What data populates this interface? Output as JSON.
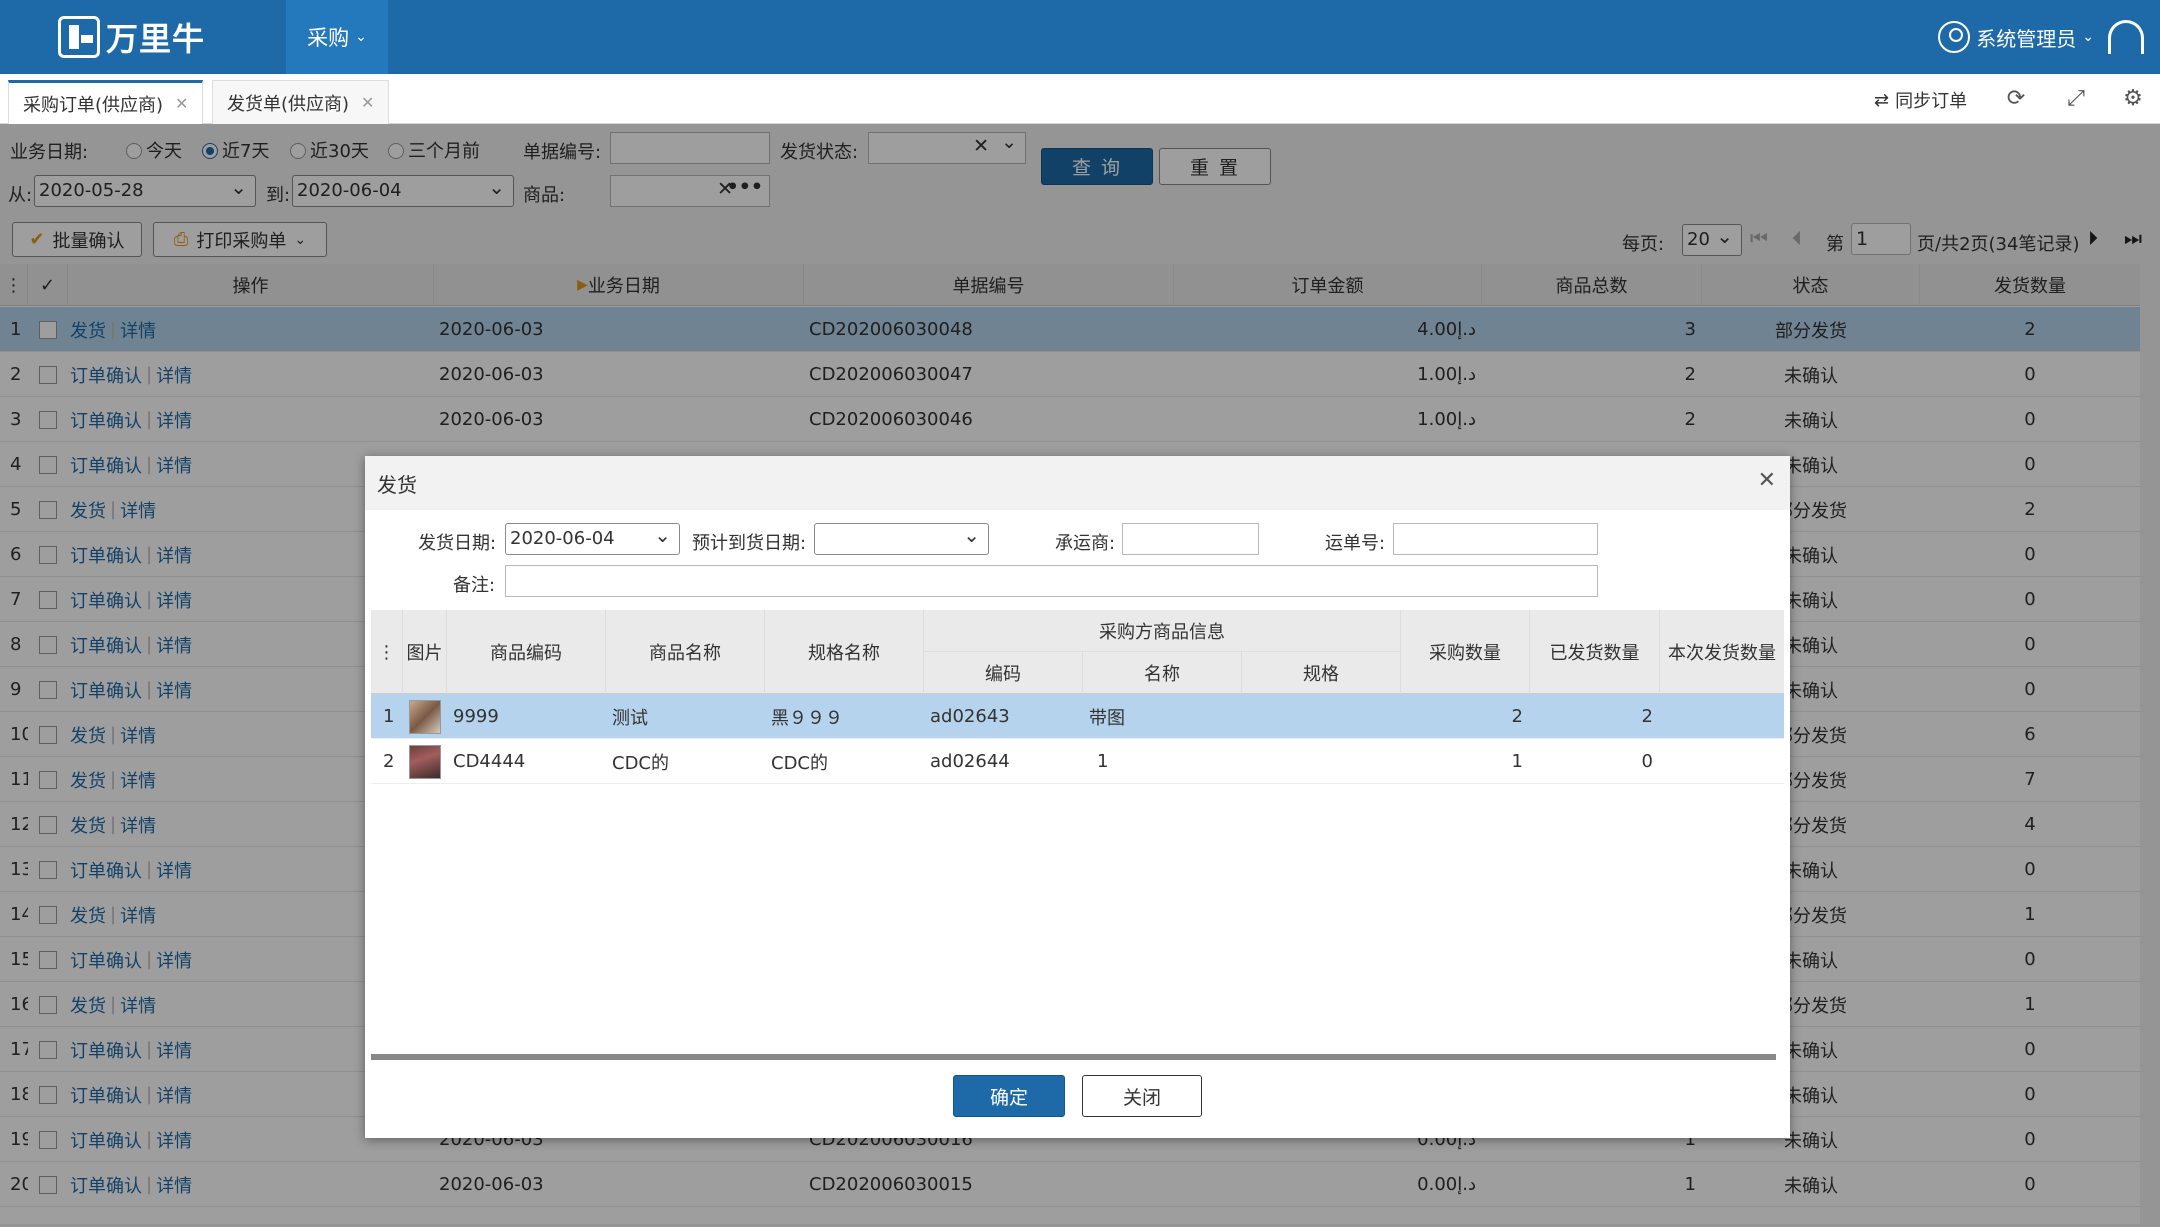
{
  "app": {
    "name": "万里牛",
    "menu": "采购",
    "user": "系统管理员"
  },
  "tabs": [
    {
      "label": "采购订单(供应商)"
    },
    {
      "label": "发货单(供应商)"
    }
  ],
  "toolbar": {
    "sync_label": "同步订单"
  },
  "filters": {
    "biz_date_label": "业务日期:",
    "date_options": [
      "今天",
      "近7天",
      "近30天",
      "三个月前"
    ],
    "selected_option": "近7天",
    "doc_no_label": "单据编号:",
    "ship_status_label": "发货状态:",
    "query_button": "查 询",
    "reset_button": "重 置",
    "from_label": "从:",
    "from_value": "2020-05-28",
    "to_label": "到:",
    "to_value": "2020-06-04",
    "product_label": "商品:"
  },
  "actions": {
    "batch_confirm": "批量确认",
    "print_order": "打印采购单"
  },
  "pager": {
    "per_page_label": "每页:",
    "per_page": "20",
    "page_prefix": "第",
    "page": "1",
    "page_suffix": "页/共2页(34笔记录)"
  },
  "grid": {
    "columns": [
      "操作",
      "业务日期",
      "单据编号",
      "订单金额",
      "商品总数",
      "状态",
      "发货数量"
    ],
    "rows": [
      {
        "no": "1",
        "ops": [
          "发货",
          "详情"
        ],
        "date": "2020-06-03",
        "code": "CD202006030048",
        "amount": "4.00د.إ",
        "qty": "3",
        "status": "部分发货",
        "ship": "2"
      },
      {
        "no": "2",
        "ops": [
          "订单确认",
          "详情"
        ],
        "date": "2020-06-03",
        "code": "CD202006030047",
        "amount": "1.00د.إ",
        "qty": "2",
        "status": "未确认",
        "ship": "0"
      },
      {
        "no": "3",
        "ops": [
          "订单确认",
          "详情"
        ],
        "date": "2020-06-03",
        "code": "CD202006030046",
        "amount": "1.00د.إ",
        "qty": "2",
        "status": "未确认",
        "ship": "0"
      },
      {
        "no": "4",
        "ops": [
          "订单确认",
          "详情"
        ],
        "date": "",
        "code": "",
        "amount": "",
        "qty": "",
        "status": "未确认",
        "ship": "0"
      },
      {
        "no": "5",
        "ops": [
          "发货",
          "详情"
        ],
        "date": "",
        "code": "",
        "amount": "",
        "qty": "",
        "status": "部分发货",
        "ship": "2"
      },
      {
        "no": "6",
        "ops": [
          "订单确认",
          "详情"
        ],
        "date": "",
        "code": "",
        "amount": "",
        "qty": "",
        "status": "未确认",
        "ship": "0"
      },
      {
        "no": "7",
        "ops": [
          "订单确认",
          "详情"
        ],
        "date": "",
        "code": "",
        "amount": "",
        "qty": "",
        "status": "未确认",
        "ship": "0"
      },
      {
        "no": "8",
        "ops": [
          "订单确认",
          "详情"
        ],
        "date": "",
        "code": "",
        "amount": "",
        "qty": "",
        "status": "未确认",
        "ship": "0"
      },
      {
        "no": "9",
        "ops": [
          "订单确认",
          "详情"
        ],
        "date": "",
        "code": "",
        "amount": "",
        "qty": "",
        "status": "未确认",
        "ship": "0"
      },
      {
        "no": "10",
        "ops": [
          "发货",
          "详情"
        ],
        "date": "",
        "code": "",
        "amount": "",
        "qty": "",
        "status": "部分发货",
        "ship": "6"
      },
      {
        "no": "11",
        "ops": [
          "发货",
          "详情"
        ],
        "date": "",
        "code": "",
        "amount": "",
        "qty": "",
        "status": "部分发货",
        "ship": "7"
      },
      {
        "no": "12",
        "ops": [
          "发货",
          "详情"
        ],
        "date": "",
        "code": "",
        "amount": "",
        "qty": "",
        "status": "部分发货",
        "ship": "4"
      },
      {
        "no": "13",
        "ops": [
          "订单确认",
          "详情"
        ],
        "date": "",
        "code": "",
        "amount": "",
        "qty": "",
        "status": "未确认",
        "ship": "0"
      },
      {
        "no": "14",
        "ops": [
          "发货",
          "详情"
        ],
        "date": "",
        "code": "",
        "amount": "",
        "qty": "",
        "status": "部分发货",
        "ship": "1"
      },
      {
        "no": "15",
        "ops": [
          "订单确认",
          "详情"
        ],
        "date": "",
        "code": "",
        "amount": "",
        "qty": "",
        "status": "未确认",
        "ship": "0"
      },
      {
        "no": "16",
        "ops": [
          "发货",
          "详情"
        ],
        "date": "",
        "code": "",
        "amount": "",
        "qty": "",
        "status": "部分发货",
        "ship": "1"
      },
      {
        "no": "17",
        "ops": [
          "订单确认",
          "详情"
        ],
        "date": "",
        "code": "",
        "amount": "",
        "qty": "",
        "status": "未确认",
        "ship": "0"
      },
      {
        "no": "18",
        "ops": [
          "订单确认",
          "详情"
        ],
        "date": "",
        "code": "",
        "amount": "",
        "qty": "",
        "status": "未确认",
        "ship": "0"
      },
      {
        "no": "19",
        "ops": [
          "订单确认",
          "详情"
        ],
        "date": "2020-06-03",
        "code": "CD202006030016",
        "amount": "0.00د.إ",
        "qty": "1",
        "status": "未确认",
        "ship": "0"
      },
      {
        "no": "20",
        "ops": [
          "订单确认",
          "详情"
        ],
        "date": "2020-06-03",
        "code": "CD202006030015",
        "amount": "0.00د.إ",
        "qty": "1",
        "status": "未确认",
        "ship": "0"
      }
    ]
  },
  "dialog": {
    "title": "发货",
    "ship_date_label": "发货日期:",
    "ship_date_value": "2020-06-04",
    "eta_label": "预计到货日期:",
    "carrier_label": "承运商:",
    "waybill_label": "运单号:",
    "remark_label": "备注:",
    "columns": {
      "image": "图片",
      "code": "商品编码",
      "name": "商品名称",
      "spec": "规格名称",
      "buyer_group": "采购方商品信息",
      "buyer_code": "编码",
      "buyer_name": "名称",
      "buyer_spec": "规格",
      "purchase_qty": "采购数量",
      "shipped_qty": "已发货数量",
      "this_qty": "本次发货数量"
    },
    "items": [
      {
        "no": "1",
        "code": "9999",
        "name": "测试",
        "spec": "黑９９９",
        "buyer_code": "ad02643",
        "buyer_name": "带图",
        "buyer_spec": "",
        "purchase_qty": "2",
        "shipped_qty": "2"
      },
      {
        "no": "2",
        "code": "CD4444",
        "name": "CDC的",
        "spec": "CDC的",
        "buyer_code": "ad02644",
        "buyer_name": "1",
        "buyer_spec": "",
        "purchase_qty": "1",
        "shipped_qty": "0"
      }
    ],
    "confirm_button": "确定",
    "close_button": "关闭"
  }
}
